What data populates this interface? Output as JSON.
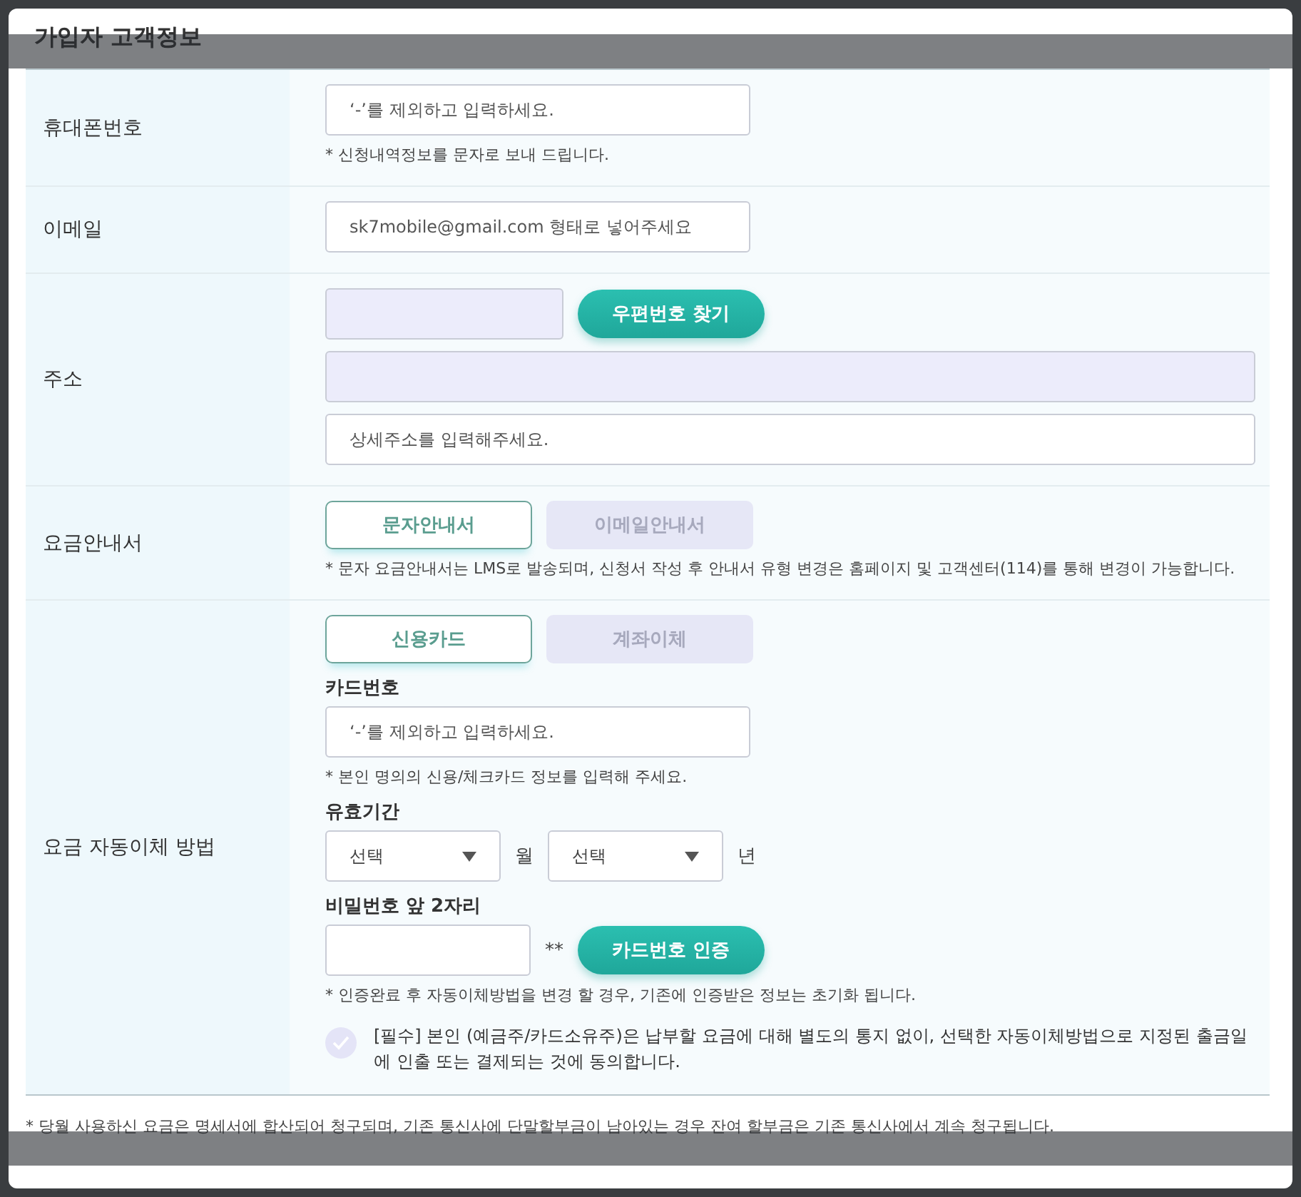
{
  "title": "가입자 고객정보",
  "rows": [
    {
      "label": "휴대폰번호",
      "lines": [
        [
          {
            "kind": "input",
            "placeholder": "‘-’를 제외하고 입력하세요."
          }
        ],
        [
          {
            "kind": "note",
            "text": "* 신청내역정보를 문자로 보내 드립니다."
          }
        ]
      ]
    },
    {
      "label": "이메일",
      "lines": [
        [
          {
            "kind": "input",
            "placeholder": "sk7mobile@gmail.com 형태로 넣어주세요"
          }
        ]
      ]
    },
    {
      "label": "주소",
      "lines": [
        [
          {
            "kind": "input-short",
            "readonly": true
          },
          {
            "kind": "button",
            "text": "우편번호 찾기"
          }
        ],
        [
          {
            "kind": "input-full",
            "readonly": true
          }
        ],
        [
          {
            "kind": "input-full",
            "placeholder": "상세주소를 입력해주세요."
          }
        ]
      ]
    },
    {
      "label": "요금안내서",
      "lines": [
        [
          {
            "kind": "choice",
            "options": [
              {
                "label": "문자안내서",
                "selected": true
              },
              {
                "label": "이메일안내서",
                "selected": false
              }
            ]
          }
        ],
        [
          {
            "kind": "note",
            "text": "* 문자 요금안내서는 LMS로 발송되며, 신청서 작성 후 안내서 유형 변경은 홈페이지 및 고객센터(114)를 통해 변경이 가능합니다."
          }
        ]
      ]
    },
    {
      "label": "요금 자동이체 방법",
      "lines": [
        [
          {
            "kind": "choice",
            "options": [
              {
                "label": "신용카드",
                "selected": true
              },
              {
                "label": "계좌이체",
                "selected": false
              }
            ]
          }
        ],
        [
          {
            "kind": "heading",
            "text": "카드번호"
          }
        ],
        [
          {
            "kind": "input",
            "placeholder": "‘-’를 제외하고 입력하세요."
          }
        ],
        [
          {
            "kind": "note",
            "text": "* 본인 명의의 신용/체크카드 정보를 입력해 주세요."
          }
        ],
        [
          {
            "kind": "heading",
            "text": "유효기간"
          }
        ],
        [
          {
            "kind": "select",
            "value": "선택"
          },
          {
            "kind": "unit",
            "text": "월"
          },
          {
            "kind": "select",
            "value": "선택"
          },
          {
            "kind": "unit",
            "text": "년"
          }
        ],
        [
          {
            "kind": "heading",
            "text": "비밀번호 앞 2자리"
          }
        ],
        [
          {
            "kind": "input-pin"
          },
          {
            "kind": "unit",
            "text": "**"
          },
          {
            "kind": "button",
            "text": "카드번호 인증"
          }
        ],
        [
          {
            "kind": "note",
            "text": "* 인증완료 후 자동이체방법을 변경 할 경우, 기존에 인증받은 정보는 초기화 됩니다."
          }
        ],
        [
          {
            "kind": "agree",
            "checked": false,
            "text": "[필수] 본인 (예금주/카드소유주)은 납부할 요금에 대해 별도의 통지 없이, 선택한 자동이체방법으로 지정된 출금일에 인출 또는 결제되는 것에 동의합니다."
          }
        ]
      ]
    }
  ],
  "footnote": "* 당월 사용하신 요금은 명세서에 합산되어 청구되며, 기존 통신사에 단말할부금이 남아있는 경우 잔여 할부금은 기존 통신사에서 계속 청구됩니다."
}
